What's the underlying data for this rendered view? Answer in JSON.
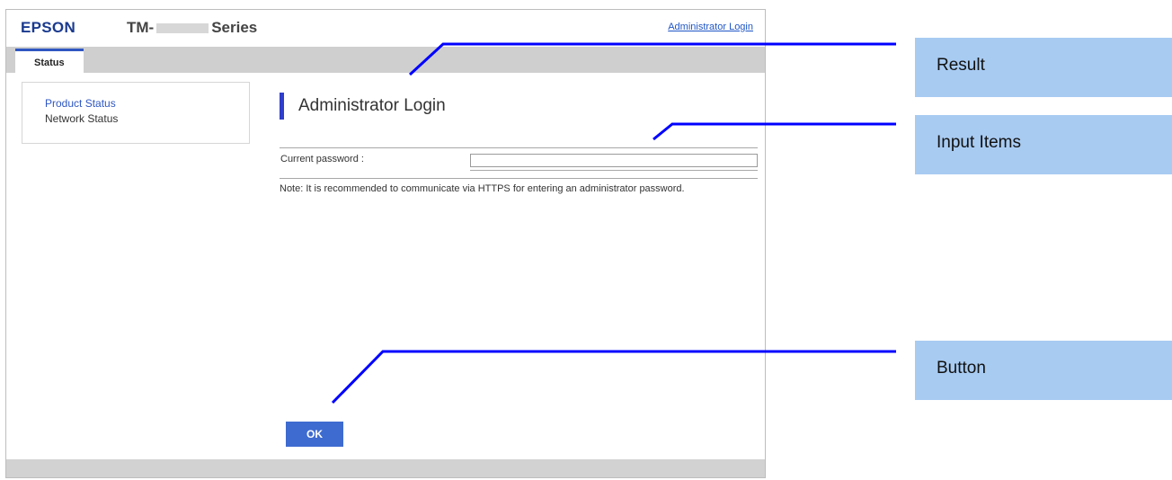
{
  "header": {
    "logo": "EPSON",
    "model_prefix": "TM-",
    "model_suffix": "Series",
    "admin_link": "Administrator Login"
  },
  "tabs": [
    {
      "label": "Status",
      "active": true
    }
  ],
  "sidebar": {
    "items": [
      {
        "label": "Product Status",
        "active": true
      },
      {
        "label": "Network Status",
        "active": false
      }
    ]
  },
  "main": {
    "title": "Administrator Login",
    "form": {
      "password_label": "Current password :",
      "password_value": ""
    },
    "note": "Note: It is recommended to communicate via HTTPS for entering an administrator password.",
    "ok_label": "OK"
  },
  "callouts": {
    "result": "Result",
    "input_items": "Input Items",
    "button": "Button"
  },
  "colors": {
    "brand_blue": "#1a3a8f",
    "accent_blue": "#2f3ecb",
    "button_blue": "#3e6bd0",
    "callout_fill": "#a8cbf2",
    "callout_line": "#0000ff"
  }
}
